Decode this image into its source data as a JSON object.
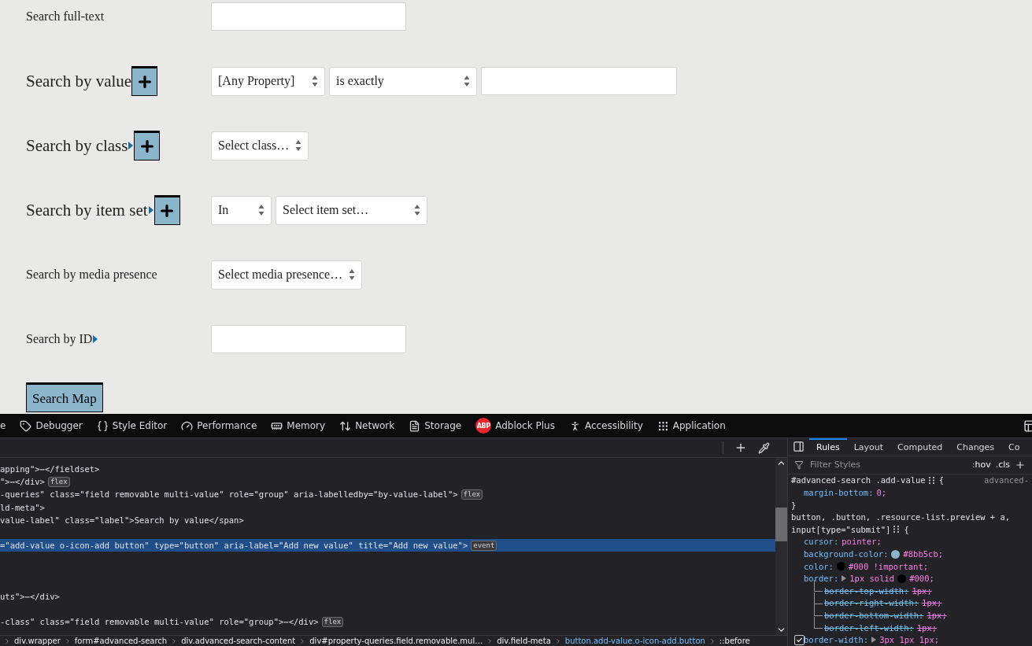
{
  "form": {
    "fields": [
      {
        "label": "Search full-text",
        "controls": [
          {
            "kind": "text"
          }
        ]
      },
      {
        "label": "Search by value",
        "add_button": true,
        "controls": [
          {
            "kind": "select",
            "value": "[Any Property]"
          },
          {
            "kind": "select",
            "value": "is exactly"
          },
          {
            "kind": "text"
          }
        ]
      },
      {
        "label": "Search by class",
        "expander": true,
        "add_button": true,
        "controls": [
          {
            "kind": "select",
            "value": "Select class…"
          }
        ]
      },
      {
        "label": "Search by item set",
        "expander": true,
        "add_button": true,
        "controls": [
          {
            "kind": "select",
            "value": "In"
          },
          {
            "kind": "select",
            "value": "Select item set…"
          }
        ]
      },
      {
        "label": "Search by media presence",
        "controls": [
          {
            "kind": "select",
            "value": "Select media presence…"
          }
        ]
      },
      {
        "label": "Search by ID",
        "expander": true,
        "controls": [
          {
            "kind": "text"
          }
        ]
      }
    ],
    "submit": "Search Map"
  },
  "devtools": {
    "tabs": [
      {
        "label": "e",
        "kind": "text"
      },
      {
        "label": "Debugger",
        "kind": "debugger"
      },
      {
        "label": "Style Editor",
        "kind": "braces"
      },
      {
        "label": "Performance",
        "kind": "gauge"
      },
      {
        "label": "Memory",
        "kind": "memory"
      },
      {
        "label": "Network",
        "kind": "network"
      },
      {
        "label": "Storage",
        "kind": "storage"
      },
      {
        "label": "Adblock Plus",
        "kind": "adblock",
        "icon_text": "ABP"
      },
      {
        "label": "Accessibility",
        "kind": "accessibility"
      },
      {
        "label": "Application",
        "kind": "application"
      }
    ],
    "markup": [
      {
        "kind": "line",
        "text": "apping\">⋯</fieldset>",
        "selected": false
      },
      {
        "kind": "line",
        "text": "\">⋯</div>",
        "badge": "flex",
        "selected": false
      },
      {
        "kind": "line",
        "text": "-queries\" class=\"field removable multi-value\" role=\"group\" aria-labelledby=\"by-value-label\">",
        "badge": "flex",
        "selected": false
      },
      {
        "kind": "line",
        "text": "ld-meta\">",
        "selected": false
      },
      {
        "kind": "line",
        "text": "value-label\" class=\"label\">Search by value</span>",
        "selected": false
      },
      {
        "kind": "blank",
        "selected": false
      },
      {
        "kind": "line",
        "text": "=\"add-value o-icon-add button\" type=\"button\" aria-label=\"Add new value\" title=\"Add new value\">",
        "badge": "event",
        "selected": true
      },
      {
        "kind": "blank",
        "selected": false
      },
      {
        "kind": "blank",
        "selected": false
      },
      {
        "kind": "blank",
        "selected": false
      },
      {
        "kind": "line",
        "text": "uts\">⋯</div>",
        "selected": false
      },
      {
        "kind": "blank",
        "selected": false
      },
      {
        "kind": "line",
        "text": "-class\" class=\"field removable multi-value\" role=\"group\">⋯</div>",
        "badge": "flex",
        "selected": false
      }
    ],
    "breadcrumbs": [
      {
        "label": "div.wrapper",
        "selected": false
      },
      {
        "label": "form#advanced-search",
        "selected": false
      },
      {
        "label": "div.advanced-search-content",
        "selected": false
      },
      {
        "label": "div#property-queries.field.removable.mul…",
        "selected": false
      },
      {
        "label": "div.field-meta",
        "selected": false
      },
      {
        "label": "button.add-value.o-icon-add.button",
        "selected": true
      },
      {
        "label": "::before",
        "selected": false
      }
    ],
    "side_tabs": [
      {
        "label": "Rules",
        "selected": true
      },
      {
        "label": "Layout",
        "selected": false
      },
      {
        "label": "Computed",
        "selected": false
      },
      {
        "label": "Changes",
        "selected": false
      },
      {
        "label": "Co",
        "selected": false
      }
    ],
    "filter": {
      "placeholder": "Filter Styles",
      "buttons": [
        ":hov",
        ".cls"
      ]
    },
    "rules": [
      {
        "kind": "selector",
        "text": "#advanced-search .add-value",
        "brace": "{",
        "source": "advanced-"
      },
      {
        "kind": "decl",
        "name": "margin-bottom:",
        "value": "0;"
      },
      {
        "kind": "close",
        "text": "}"
      },
      {
        "kind": "selector",
        "text": "button, .button, .resource-list.preview + a,"
      },
      {
        "kind": "selector",
        "text": "input[type=\"submit\"]",
        "brace": "{"
      },
      {
        "kind": "decl",
        "name": "cursor:",
        "value": "pointer;"
      },
      {
        "kind": "decl",
        "name": "background-color:",
        "color": "#8bb5cb",
        "value": "#8bb5cb;"
      },
      {
        "kind": "decl",
        "name": "color:",
        "color": "#000000",
        "value": "#000 !important;"
      },
      {
        "kind": "decl",
        "name": "border:",
        "expander": true,
        "value": "1px solid",
        "color": "#000000",
        "value2": "#000;"
      },
      {
        "kind": "sub",
        "name": "border-top-width:",
        "value": "1px;"
      },
      {
        "kind": "sub",
        "name": "border-right-width:",
        "value": "1px;"
      },
      {
        "kind": "sub",
        "name": "border-bottom-width:",
        "value": "1px;"
      },
      {
        "kind": "sub",
        "name": "border-left-width:",
        "value": "1px;"
      },
      {
        "kind": "decl",
        "name": "border-width:",
        "checked": true,
        "expander": true,
        "value": "3px 1px 1px;"
      }
    ]
  }
}
